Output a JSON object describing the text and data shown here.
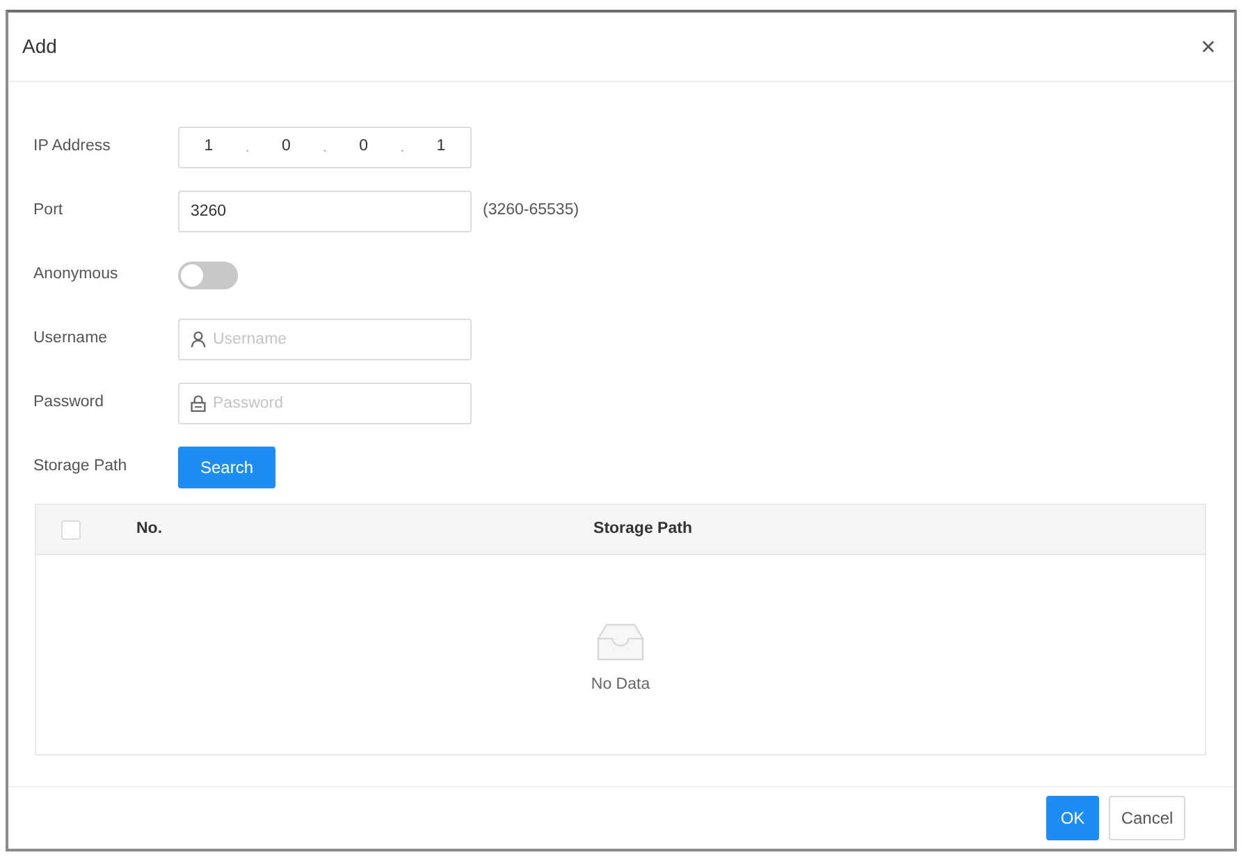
{
  "window": {
    "title": "Add"
  },
  "form": [
    {
      "kind": "ip",
      "label": "IP Address",
      "segments": [
        "1",
        "0",
        "0",
        "1"
      ],
      "separator": "."
    },
    {
      "kind": "text",
      "label": "Port",
      "value": "3260",
      "hint": "(3260-65535)"
    },
    {
      "kind": "switch",
      "label": "Anonymous",
      "on": false
    },
    {
      "kind": "user",
      "label": "Username",
      "placeholder": "Username"
    },
    {
      "kind": "password",
      "label": "Password",
      "placeholder": "Password"
    },
    {
      "kind": "action",
      "label": "Storage Path",
      "button": "Search"
    }
  ],
  "table": {
    "select_all": {
      "checked": false
    },
    "columns": [
      "No.",
      "Storage Path"
    ],
    "empty_text": "No Data"
  },
  "buttons": [
    {
      "label": "OK",
      "kind": "primary"
    },
    {
      "label": "Cancel",
      "kind": "secondary"
    }
  ]
}
